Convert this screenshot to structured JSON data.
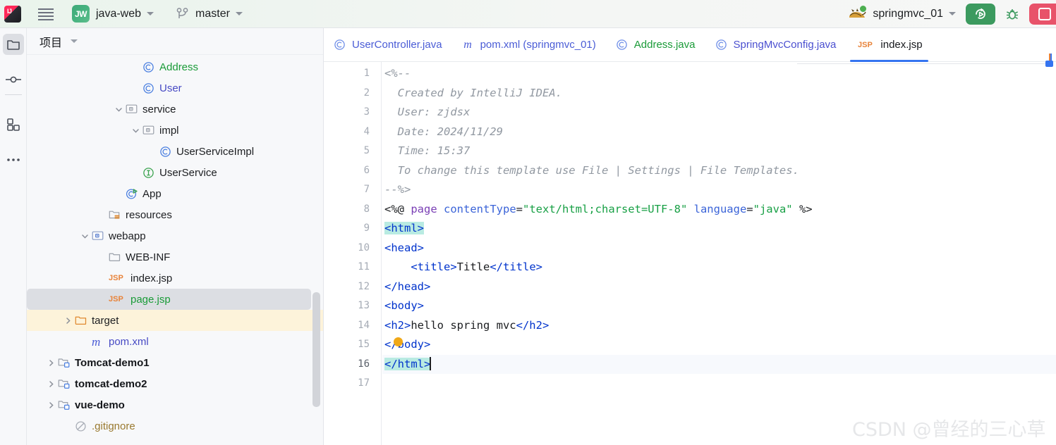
{
  "topbar": {
    "logo_alt": "IntelliJ IDEA",
    "menu_icon": "hamburger-menu-icon",
    "project_badge": "JW",
    "project_name": "java-web",
    "vcs_icon": "git-branch-icon",
    "branch_name": "master",
    "run_config_icon": "tomcat-cat-icon",
    "run_config_name": "springmvc_01",
    "run_button": "run-icon",
    "debug_button": "debug-bug-icon",
    "stop_button": "stop-icon"
  },
  "rail": {
    "items": [
      {
        "name": "project-tool-window",
        "icon": "folder-icon",
        "selected": true
      },
      {
        "name": "commit-tool-window",
        "icon": "commit-node-icon",
        "selected": false
      },
      {
        "name": "structure-tool-window",
        "icon": "structure-squares-icon",
        "selected": false
      },
      {
        "name": "more-tool-windows",
        "icon": "more-dots-icon",
        "selected": false
      }
    ]
  },
  "project_panel": {
    "title": "项目",
    "dropdown_icon": "chevron-down-icon",
    "tree": [
      {
        "label": "Address",
        "indent": 6,
        "icon": "java-class-icon",
        "color": "green",
        "arrow": "none",
        "state": "normal"
      },
      {
        "label": "User",
        "indent": 6,
        "icon": "java-class-icon",
        "color": "purple",
        "arrow": "none",
        "state": "normal"
      },
      {
        "label": "service",
        "indent": 5,
        "icon": "package-folder-icon",
        "color": "plain",
        "arrow": "expanded",
        "state": "normal"
      },
      {
        "label": "impl",
        "indent": 6,
        "icon": "package-folder-icon",
        "color": "plain",
        "arrow": "expanded",
        "state": "normal"
      },
      {
        "label": "UserServiceImpl",
        "indent": 7,
        "icon": "java-class-icon",
        "color": "plain",
        "arrow": "none",
        "state": "normal"
      },
      {
        "label": "UserService",
        "indent": 6,
        "icon": "java-interface-icon",
        "color": "plain",
        "arrow": "none",
        "state": "normal"
      },
      {
        "label": "App",
        "indent": 5,
        "icon": "java-runnable-class-icon",
        "color": "plain",
        "arrow": "none",
        "state": "normal"
      },
      {
        "label": "resources",
        "indent": 4,
        "icon": "resources-folder-icon",
        "color": "plain",
        "arrow": "none",
        "state": "normal"
      },
      {
        "label": "webapp",
        "indent": 3,
        "icon": "source-folder-icon",
        "color": "plain",
        "arrow": "expanded",
        "state": "normal"
      },
      {
        "label": "WEB-INF",
        "indent": 4,
        "icon": "plain-folder-icon",
        "color": "plain",
        "arrow": "none",
        "state": "normal"
      },
      {
        "label": "index.jsp",
        "indent": 4,
        "icon": "jsp-file-icon",
        "color": "plain",
        "arrow": "none",
        "state": "normal"
      },
      {
        "label": "page.jsp",
        "indent": 4,
        "icon": "jsp-file-icon",
        "color": "green",
        "arrow": "none",
        "state": "selected"
      },
      {
        "label": "target",
        "indent": 2,
        "icon": "excluded-folder-icon",
        "color": "plain",
        "arrow": "collapsed",
        "state": "excluded"
      },
      {
        "label": "pom.xml",
        "indent": 3,
        "icon": "maven-file-icon",
        "color": "purple",
        "arrow": "none",
        "state": "normal"
      },
      {
        "label": "Tomcat-demo1",
        "indent": 1,
        "icon": "module-folder-icon",
        "color": "bold",
        "arrow": "collapsed",
        "state": "normal"
      },
      {
        "label": "tomcat-demo2",
        "indent": 1,
        "icon": "module-folder-icon",
        "color": "bold",
        "arrow": "collapsed",
        "state": "normal"
      },
      {
        "label": "vue-demo",
        "indent": 1,
        "icon": "module-folder-icon",
        "color": "bold",
        "arrow": "collapsed",
        "state": "normal"
      },
      {
        "label": ".gitignore",
        "indent": 2,
        "icon": "ignored-file-icon",
        "color": "olive",
        "arrow": "none",
        "state": "normal"
      }
    ]
  },
  "editor": {
    "tabs": [
      {
        "label": "UserController.java",
        "icon": "java-class-icon",
        "color": "c-blue",
        "active": false
      },
      {
        "label": "pom.xml (springmvc_01)",
        "icon": "maven-file-icon",
        "color": "c-blue",
        "active": false
      },
      {
        "label": "Address.java",
        "icon": "java-class-icon",
        "color": "c-green",
        "active": false
      },
      {
        "label": "SpringMvcConfig.java",
        "icon": "java-class-icon",
        "color": "c-purple",
        "active": false
      },
      {
        "label": "index.jsp",
        "icon": "jsp-file-icon",
        "color": "c-dark",
        "active": true
      }
    ],
    "line_numbers": [
      "1",
      "2",
      "3",
      "4",
      "5",
      "6",
      "7",
      "8",
      "9",
      "10",
      "11",
      "12",
      "13",
      "14",
      "15",
      "16",
      "17"
    ],
    "current_line": 16,
    "caret_line": 16,
    "lines": [
      {
        "n": 1,
        "tokens": [
          {
            "t": "<%--",
            "c": "cm"
          }
        ]
      },
      {
        "n": 2,
        "tokens": [
          {
            "t": "  Created by IntelliJ IDEA.",
            "c": "cm"
          }
        ]
      },
      {
        "n": 3,
        "tokens": [
          {
            "t": "  User: zjdsx",
            "c": "cm"
          }
        ]
      },
      {
        "n": 4,
        "tokens": [
          {
            "t": "  Date: 2024/11/29",
            "c": "cm"
          }
        ]
      },
      {
        "n": 5,
        "tokens": [
          {
            "t": "  Time: 15:37",
            "c": "cm"
          }
        ]
      },
      {
        "n": 6,
        "tokens": [
          {
            "t": "  To change this template use File | Settings | File Templates.",
            "c": "cm"
          }
        ]
      },
      {
        "n": 7,
        "tokens": [
          {
            "t": "--%>",
            "c": "cm"
          }
        ]
      },
      {
        "n": 8,
        "tokens": [
          {
            "t": "<%@ ",
            "c": "pl"
          },
          {
            "t": "page ",
            "c": "kw"
          },
          {
            "t": "contentType",
            "c": "at"
          },
          {
            "t": "=",
            "c": "pl"
          },
          {
            "t": "\"text/html;charset=UTF-8\"",
            "c": "st"
          },
          {
            "t": " ",
            "c": "pl"
          },
          {
            "t": "language",
            "c": "at"
          },
          {
            "t": "=",
            "c": "pl"
          },
          {
            "t": "\"java\"",
            "c": "st"
          },
          {
            "t": " %>",
            "c": "pl"
          }
        ]
      },
      {
        "n": 9,
        "tokens": [
          {
            "t": "<html>",
            "c": "tg",
            "hl": true
          }
        ]
      },
      {
        "n": 10,
        "tokens": [
          {
            "t": "<head>",
            "c": "tg"
          }
        ]
      },
      {
        "n": 11,
        "tokens": [
          {
            "t": "    <title>",
            "c": "tg"
          },
          {
            "t": "Title",
            "c": "pl"
          },
          {
            "t": "</title>",
            "c": "tg"
          }
        ]
      },
      {
        "n": 12,
        "tokens": [
          {
            "t": "</head>",
            "c": "tg"
          }
        ]
      },
      {
        "n": 13,
        "tokens": [
          {
            "t": "<body>",
            "c": "tg"
          }
        ]
      },
      {
        "n": 14,
        "tokens": [
          {
            "t": "<h2>",
            "c": "tg"
          },
          {
            "t": "hello spring mvc",
            "c": "pl"
          },
          {
            "t": "</h2>",
            "c": "tg"
          }
        ]
      },
      {
        "n": 15,
        "tokens": [
          {
            "t": "</body>",
            "c": "tg"
          }
        ]
      },
      {
        "n": 16,
        "tokens": [
          {
            "t": "</html>",
            "c": "tg",
            "hl": true
          }
        ],
        "caret": true
      },
      {
        "n": 17,
        "tokens": [
          {
            "t": "",
            "c": "pl"
          }
        ]
      }
    ],
    "intention_bulb": "intention-bulb-icon"
  },
  "watermark": "CSDN @曾经的三心草",
  "colors": {
    "accent_blue": "#3574f0",
    "run_green": "#3c9a5f",
    "stop_red": "#e8536a",
    "vcs_green": "#1a9b38",
    "selection_gray": "#dcdee3",
    "excluded_yellow": "#fdf3da",
    "tag_blue": "#0033cc",
    "string_green": "#18a045",
    "match_highlight": "#b9ebe2"
  }
}
